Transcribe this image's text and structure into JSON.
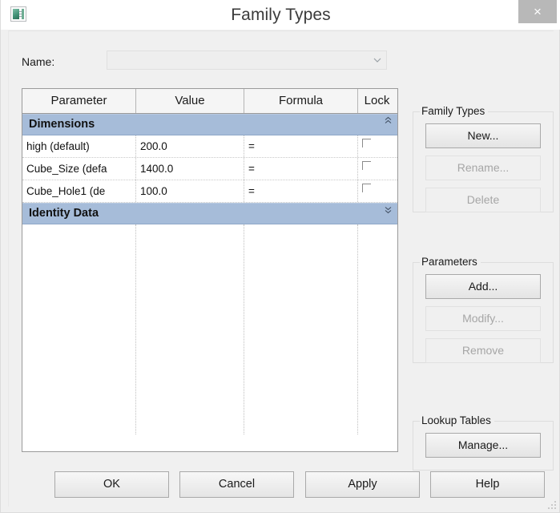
{
  "window": {
    "title": "Family Types",
    "app_icon": "family-editor-icon",
    "close_label": "×"
  },
  "name_row": {
    "label": "Name:",
    "value": "",
    "placeholder": "",
    "dropdown_icon": "chevron-down-icon"
  },
  "table": {
    "columns": [
      "Parameter",
      "Value",
      "Formula",
      "Lock"
    ],
    "groups": [
      {
        "label": "Dimensions",
        "chevron": "chevron-up-icon",
        "rows": [
          {
            "parameter": "high (default)",
            "value": "200.0",
            "formula": "=",
            "lock": false
          },
          {
            "parameter": "Cube_Size (defa",
            "value": "1400.0",
            "formula": "=",
            "lock": false
          },
          {
            "parameter": "Cube_Hole1 (de",
            "value": "100.0",
            "formula": "=",
            "lock": false
          }
        ]
      },
      {
        "label": "Identity Data",
        "chevron": "chevron-down-icon",
        "rows": []
      }
    ]
  },
  "panels": [
    {
      "title": "Family Types",
      "buttons": [
        {
          "label": "New...",
          "enabled": true
        },
        {
          "label": "Rename...",
          "enabled": false
        },
        {
          "label": "Delete",
          "enabled": false
        }
      ]
    },
    {
      "title": "Parameters",
      "buttons": [
        {
          "label": "Add...",
          "enabled": true
        },
        {
          "label": "Modify...",
          "enabled": false
        },
        {
          "label": "Remove",
          "enabled": false
        }
      ]
    },
    {
      "title": "Lookup Tables",
      "buttons": [
        {
          "label": "Manage...",
          "enabled": true
        }
      ]
    }
  ],
  "footer": {
    "ok": "OK",
    "cancel": "Cancel",
    "apply": "Apply",
    "help": "Help"
  },
  "colors": {
    "group_header_blue": "#a6bcd9",
    "dialog_background": "#f0f0f0",
    "close_button": "#b8b8b8",
    "table_background": "#ffffff",
    "title_text": "#3b3b3b",
    "disabled_text": "#a6a6a6"
  }
}
